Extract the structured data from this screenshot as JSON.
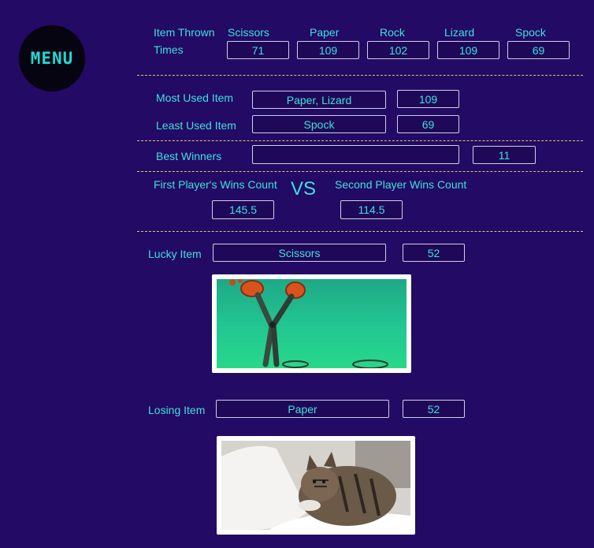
{
  "menu": {
    "label": "MENU"
  },
  "items_thrown": {
    "header_label": "Item Thrown",
    "times_label": "Times",
    "columns": [
      {
        "name": "Scissors",
        "count": "71"
      },
      {
        "name": "Paper",
        "count": "109"
      },
      {
        "name": "Rock",
        "count": "102"
      },
      {
        "name": "Lizard",
        "count": "109"
      },
      {
        "name": "Spock",
        "count": "69"
      }
    ]
  },
  "most_used": {
    "label": "Most Used Item",
    "value": "Paper, Lizard",
    "count": "109"
  },
  "least_used": {
    "label": "Least Used Item",
    "value": "Spock",
    "count": "69"
  },
  "best_winners": {
    "label": "Best Winners",
    "value": "",
    "count": "11"
  },
  "wins": {
    "first_label": "First Player's Wins Count",
    "vs": "VS",
    "second_label": "Second Player Wins Count",
    "first_value": "145.5",
    "second_value": "114.5"
  },
  "lucky": {
    "label": "Lucky Item",
    "value": "Scissors",
    "count": "52",
    "image_icon": "scissors-animation-image"
  },
  "losing": {
    "label": "Losing Item",
    "value": "Paper",
    "count": "52",
    "image_icon": "cat-paper-image"
  },
  "colors": {
    "background": "#230a64",
    "text": "#3fe0dc",
    "separator": "#d9c76a"
  }
}
